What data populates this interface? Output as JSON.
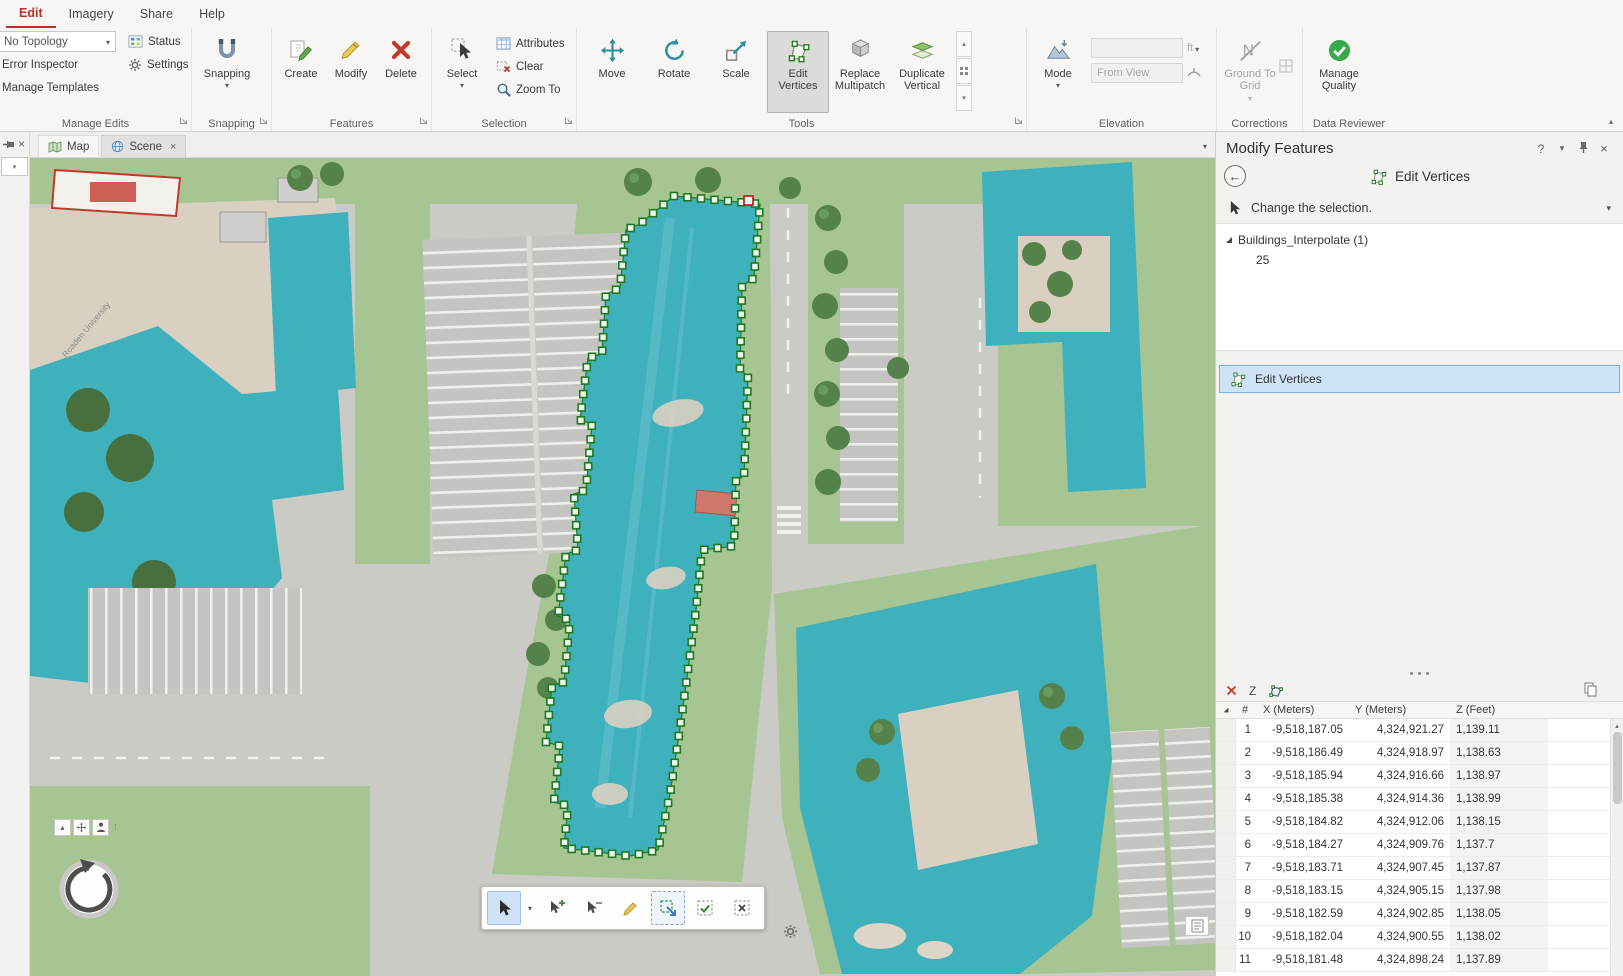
{
  "menu": {
    "edit": "Edit",
    "imagery": "Imagery",
    "share": "Share",
    "help": "Help"
  },
  "ribbon": {
    "manage_edits": {
      "no_topology": "No Topology",
      "status": "Status",
      "settings": "Settings",
      "error_inspector": "Error Inspector",
      "manage_templates": "Manage Templates",
      "label": "Manage Edits"
    },
    "snapping": {
      "button": "Snapping",
      "label": "Snapping"
    },
    "features": {
      "create": "Create",
      "modify": "Modify",
      "delete": "Delete",
      "label": "Features"
    },
    "selection": {
      "select": "Select",
      "attributes": "Attributes",
      "clear": "Clear",
      "zoom_to": "Zoom To",
      "label": "Selection"
    },
    "tools": {
      "move": "Move",
      "rotate": "Rotate",
      "scale": "Scale",
      "edit_vertices": "Edit Vertices",
      "replace_multipatch": "Replace Multipatch",
      "duplicate_vertical": "Duplicate Vertical",
      "label": "Tools"
    },
    "elevation": {
      "mode": "Mode",
      "unit": "ft",
      "from_view": "From View",
      "label": "Elevation"
    },
    "corrections": {
      "ground_to_grid": "Ground To Grid",
      "label": "Corrections"
    },
    "data_reviewer": {
      "manage_quality": "Manage Quality",
      "label": "Data Reviewer"
    }
  },
  "view_tabs": {
    "map": "Map",
    "scene": "Scene"
  },
  "map": {
    "street_label": "Roaden University"
  },
  "panel": {
    "title": "Modify Features",
    "tool_title": "Edit Vertices",
    "change_selection": "Change the selection.",
    "selection_layer": "Buildings_Interpolate (1)",
    "selection_feature": "25",
    "tool_item": "Edit Vertices",
    "grid": {
      "z_label": "Z",
      "columns": [
        "#",
        "X (Meters)",
        "Y (Meters)",
        "Z (Feet)"
      ],
      "rows": [
        [
          "1",
          "-9,518,187.05",
          "4,324,921.27",
          "1,139.11"
        ],
        [
          "2",
          "-9,518,186.49",
          "4,324,918.97",
          "1,138.63"
        ],
        [
          "3",
          "-9,518,185.94",
          "4,324,916.66",
          "1,138.97"
        ],
        [
          "4",
          "-9,518,185.38",
          "4,324,914.36",
          "1,138.99"
        ],
        [
          "5",
          "-9,518,184.82",
          "4,324,912.06",
          "1,138.15"
        ],
        [
          "6",
          "-9,518,184.27",
          "4,324,909.76",
          "1,137.7"
        ],
        [
          "7",
          "-9,518,183.71",
          "4,324,907.45",
          "1,137.87"
        ],
        [
          "8",
          "-9,518,183.15",
          "4,324,905.15",
          "1,137.98"
        ],
        [
          "9",
          "-9,518,182.59",
          "4,324,902.85",
          "1,138.05"
        ],
        [
          "10",
          "-9,518,182.04",
          "4,324,900.55",
          "1,138.02"
        ],
        [
          "11",
          "-9,518,181.48",
          "4,324,898.24",
          "1,137.89"
        ]
      ]
    }
  },
  "colors": {
    "accent_blue": "#0079c1",
    "edit_tab_red": "#b7322c",
    "building_teal": "#3fb1bd",
    "grass_green": "#a7c593",
    "road_gray": "#cacbc5",
    "selection_fill": "#cfe3f7",
    "vertex_green": "#1e7a1e",
    "vertex_red": "#c82121",
    "quality_green": "#37a84c"
  }
}
